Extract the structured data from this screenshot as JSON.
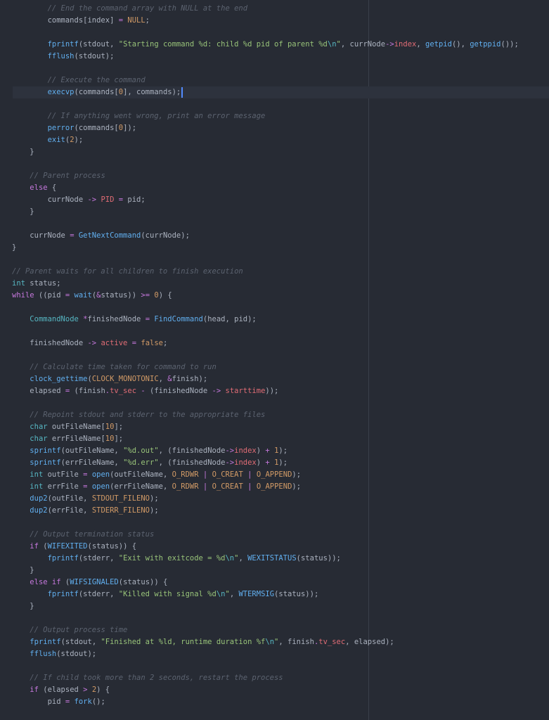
{
  "editor": {
    "cursor_line": 7,
    "lines": [
      [
        [
          "plain",
          "        "
        ],
        [
          "comment",
          "// End the command array with NULL at the end"
        ]
      ],
      [
        [
          "plain",
          "        commands[index] "
        ],
        [
          "op",
          "="
        ],
        [
          "plain",
          " "
        ],
        [
          "const",
          "NULL"
        ],
        [
          "plain",
          ";"
        ]
      ],
      [],
      [
        [
          "plain",
          "        "
        ],
        [
          "func",
          "fprintf"
        ],
        [
          "plain",
          "(stdout, "
        ],
        [
          "string",
          "\"Starting command %d: child %d pid of parent %d"
        ],
        [
          "escape",
          "\\n"
        ],
        [
          "string",
          "\""
        ],
        [
          "plain",
          ", currNode"
        ],
        [
          "op",
          "->"
        ],
        [
          "member",
          "index"
        ],
        [
          "plain",
          ", "
        ],
        [
          "func",
          "getpid"
        ],
        [
          "plain",
          "(), "
        ],
        [
          "func",
          "getppid"
        ],
        [
          "plain",
          "());"
        ]
      ],
      [
        [
          "plain",
          "        "
        ],
        [
          "func",
          "fflush"
        ],
        [
          "plain",
          "(stdout);"
        ]
      ],
      [],
      [
        [
          "plain",
          "        "
        ],
        [
          "comment",
          "// Execute the command"
        ]
      ],
      [
        [
          "plain",
          "        "
        ],
        [
          "func",
          "execvp"
        ],
        [
          "plain",
          "(commands["
        ],
        [
          "const",
          "0"
        ],
        [
          "plain",
          "], commands);"
        ]
      ],
      [],
      [
        [
          "plain",
          "        "
        ],
        [
          "comment",
          "// If anything went wrong, print an error message"
        ]
      ],
      [
        [
          "plain",
          "        "
        ],
        [
          "func",
          "perror"
        ],
        [
          "plain",
          "(commands["
        ],
        [
          "const",
          "0"
        ],
        [
          "plain",
          "]);"
        ]
      ],
      [
        [
          "plain",
          "        "
        ],
        [
          "func",
          "exit"
        ],
        [
          "plain",
          "("
        ],
        [
          "const",
          "2"
        ],
        [
          "plain",
          ");"
        ]
      ],
      [
        [
          "plain",
          "    }"
        ]
      ],
      [],
      [
        [
          "plain",
          "    "
        ],
        [
          "comment",
          "// Parent process"
        ]
      ],
      [
        [
          "plain",
          "    "
        ],
        [
          "keyword",
          "else"
        ],
        [
          "plain",
          " {"
        ]
      ],
      [
        [
          "plain",
          "        currNode "
        ],
        [
          "op",
          "->"
        ],
        [
          "plain",
          " "
        ],
        [
          "member",
          "PID"
        ],
        [
          "plain",
          " "
        ],
        [
          "op",
          "="
        ],
        [
          "plain",
          " pid;"
        ]
      ],
      [
        [
          "plain",
          "    }"
        ]
      ],
      [],
      [
        [
          "plain",
          "    currNode "
        ],
        [
          "op",
          "="
        ],
        [
          "plain",
          " "
        ],
        [
          "func",
          "GetNextCommand"
        ],
        [
          "plain",
          "(currNode);"
        ]
      ],
      [
        [
          "plain",
          "}"
        ]
      ],
      [],
      [
        [
          "comment",
          "// Parent waits for all children to finish execution"
        ]
      ],
      [
        [
          "type",
          "int"
        ],
        [
          "plain",
          " status;"
        ]
      ],
      [
        [
          "keyword",
          "while"
        ],
        [
          "plain",
          " ((pid "
        ],
        [
          "op",
          "="
        ],
        [
          "plain",
          " "
        ],
        [
          "func",
          "wait"
        ],
        [
          "plain",
          "("
        ],
        [
          "op",
          "&"
        ],
        [
          "plain",
          "status)) "
        ],
        [
          "op",
          ">="
        ],
        [
          "plain",
          " "
        ],
        [
          "const",
          "0"
        ],
        [
          "plain",
          ") {"
        ]
      ],
      [],
      [
        [
          "plain",
          "    "
        ],
        [
          "type",
          "CommandNode"
        ],
        [
          "plain",
          " "
        ],
        [
          "op",
          "*"
        ],
        [
          "plain",
          "finishedNode "
        ],
        [
          "op",
          "="
        ],
        [
          "plain",
          " "
        ],
        [
          "func",
          "FindCommand"
        ],
        [
          "plain",
          "(head, pid);"
        ]
      ],
      [],
      [
        [
          "plain",
          "    finishedNode "
        ],
        [
          "op",
          "->"
        ],
        [
          "plain",
          " "
        ],
        [
          "member",
          "active"
        ],
        [
          "plain",
          " "
        ],
        [
          "op",
          "="
        ],
        [
          "plain",
          " "
        ],
        [
          "const",
          "false"
        ],
        [
          "plain",
          ";"
        ]
      ],
      [],
      [
        [
          "plain",
          "    "
        ],
        [
          "comment",
          "// Calculate time taken for command to run"
        ]
      ],
      [
        [
          "plain",
          "    "
        ],
        [
          "func",
          "clock_gettime"
        ],
        [
          "plain",
          "("
        ],
        [
          "const",
          "CLOCK_MONOTONIC"
        ],
        [
          "plain",
          ", "
        ],
        [
          "op",
          "&"
        ],
        [
          "plain",
          "finish);"
        ]
      ],
      [
        [
          "plain",
          "    elapsed "
        ],
        [
          "op",
          "="
        ],
        [
          "plain",
          " (finish"
        ],
        [
          "op",
          "."
        ],
        [
          "member",
          "tv_sec"
        ],
        [
          "plain",
          " "
        ],
        [
          "op",
          "-"
        ],
        [
          "plain",
          " (finishedNode "
        ],
        [
          "op",
          "->"
        ],
        [
          "plain",
          " "
        ],
        [
          "member",
          "starttime"
        ],
        [
          "plain",
          "));"
        ]
      ],
      [],
      [
        [
          "plain",
          "    "
        ],
        [
          "comment",
          "// Repoint stdout and stderr to the appropriate files"
        ]
      ],
      [
        [
          "plain",
          "    "
        ],
        [
          "type",
          "char"
        ],
        [
          "plain",
          " outFileName["
        ],
        [
          "const",
          "10"
        ],
        [
          "plain",
          "];"
        ]
      ],
      [
        [
          "plain",
          "    "
        ],
        [
          "type",
          "char"
        ],
        [
          "plain",
          " errFileName["
        ],
        [
          "const",
          "10"
        ],
        [
          "plain",
          "];"
        ]
      ],
      [
        [
          "plain",
          "    "
        ],
        [
          "func",
          "sprintf"
        ],
        [
          "plain",
          "(outFileName, "
        ],
        [
          "string",
          "\"%d.out\""
        ],
        [
          "plain",
          ", (finishedNode"
        ],
        [
          "op",
          "->"
        ],
        [
          "member",
          "index"
        ],
        [
          "plain",
          ") "
        ],
        [
          "op",
          "+"
        ],
        [
          "plain",
          " "
        ],
        [
          "const",
          "1"
        ],
        [
          "plain",
          ");"
        ]
      ],
      [
        [
          "plain",
          "    "
        ],
        [
          "func",
          "sprintf"
        ],
        [
          "plain",
          "(errFileName, "
        ],
        [
          "string",
          "\"%d.err\""
        ],
        [
          "plain",
          ", (finishedNode"
        ],
        [
          "op",
          "->"
        ],
        [
          "member",
          "index"
        ],
        [
          "plain",
          ") "
        ],
        [
          "op",
          "+"
        ],
        [
          "plain",
          " "
        ],
        [
          "const",
          "1"
        ],
        [
          "plain",
          ");"
        ]
      ],
      [
        [
          "plain",
          "    "
        ],
        [
          "type",
          "int"
        ],
        [
          "plain",
          " outFile "
        ],
        [
          "op",
          "="
        ],
        [
          "plain",
          " "
        ],
        [
          "func",
          "open"
        ],
        [
          "plain",
          "(outFileName, "
        ],
        [
          "const",
          "O_RDWR"
        ],
        [
          "plain",
          " "
        ],
        [
          "op",
          "|"
        ],
        [
          "plain",
          " "
        ],
        [
          "const",
          "O_CREAT"
        ],
        [
          "plain",
          " "
        ],
        [
          "op",
          "|"
        ],
        [
          "plain",
          " "
        ],
        [
          "const",
          "O_APPEND"
        ],
        [
          "plain",
          ");"
        ]
      ],
      [
        [
          "plain",
          "    "
        ],
        [
          "type",
          "int"
        ],
        [
          "plain",
          " errFile "
        ],
        [
          "op",
          "="
        ],
        [
          "plain",
          " "
        ],
        [
          "func",
          "open"
        ],
        [
          "plain",
          "(errFileName, "
        ],
        [
          "const",
          "O_RDWR"
        ],
        [
          "plain",
          " "
        ],
        [
          "op",
          "|"
        ],
        [
          "plain",
          " "
        ],
        [
          "const",
          "O_CREAT"
        ],
        [
          "plain",
          " "
        ],
        [
          "op",
          "|"
        ],
        [
          "plain",
          " "
        ],
        [
          "const",
          "O_APPEND"
        ],
        [
          "plain",
          ");"
        ]
      ],
      [
        [
          "plain",
          "    "
        ],
        [
          "func",
          "dup2"
        ],
        [
          "plain",
          "(outFile, "
        ],
        [
          "const",
          "STDOUT_FILENO"
        ],
        [
          "plain",
          ");"
        ]
      ],
      [
        [
          "plain",
          "    "
        ],
        [
          "func",
          "dup2"
        ],
        [
          "plain",
          "(errFile, "
        ],
        [
          "const",
          "STDERR_FILENO"
        ],
        [
          "plain",
          ");"
        ]
      ],
      [],
      [
        [
          "plain",
          "    "
        ],
        [
          "comment",
          "// Output termination status"
        ]
      ],
      [
        [
          "plain",
          "    "
        ],
        [
          "keyword",
          "if"
        ],
        [
          "plain",
          " ("
        ],
        [
          "func",
          "WIFEXITED"
        ],
        [
          "plain",
          "(status)) {"
        ]
      ],
      [
        [
          "plain",
          "        "
        ],
        [
          "func",
          "fprintf"
        ],
        [
          "plain",
          "(stderr, "
        ],
        [
          "string",
          "\"Exit with exitcode = %d"
        ],
        [
          "escape",
          "\\n"
        ],
        [
          "string",
          "\""
        ],
        [
          "plain",
          ", "
        ],
        [
          "func",
          "WEXITSTATUS"
        ],
        [
          "plain",
          "(status));"
        ]
      ],
      [
        [
          "plain",
          "    }"
        ]
      ],
      [
        [
          "plain",
          "    "
        ],
        [
          "keyword",
          "else if"
        ],
        [
          "plain",
          " ("
        ],
        [
          "func",
          "WIFSIGNALED"
        ],
        [
          "plain",
          "(status)) {"
        ]
      ],
      [
        [
          "plain",
          "        "
        ],
        [
          "func",
          "fprintf"
        ],
        [
          "plain",
          "(stderr, "
        ],
        [
          "string",
          "\"Killed with signal %d"
        ],
        [
          "escape",
          "\\n"
        ],
        [
          "string",
          "\""
        ],
        [
          "plain",
          ", "
        ],
        [
          "func",
          "WTERMSIG"
        ],
        [
          "plain",
          "(status));"
        ]
      ],
      [
        [
          "plain",
          "    }"
        ]
      ],
      [],
      [
        [
          "plain",
          "    "
        ],
        [
          "comment",
          "// Output process time"
        ]
      ],
      [
        [
          "plain",
          "    "
        ],
        [
          "func",
          "fprintf"
        ],
        [
          "plain",
          "(stdout, "
        ],
        [
          "string",
          "\"Finished at %ld, runtime duration %f"
        ],
        [
          "escape",
          "\\n"
        ],
        [
          "string",
          "\""
        ],
        [
          "plain",
          ", finish"
        ],
        [
          "op",
          "."
        ],
        [
          "member",
          "tv_sec"
        ],
        [
          "plain",
          ", elapsed);"
        ]
      ],
      [
        [
          "plain",
          "    "
        ],
        [
          "func",
          "fflush"
        ],
        [
          "plain",
          "(stdout);"
        ]
      ],
      [],
      [
        [
          "plain",
          "    "
        ],
        [
          "comment",
          "// If child took more than 2 seconds, restart the process"
        ]
      ],
      [
        [
          "plain",
          "    "
        ],
        [
          "keyword",
          "if"
        ],
        [
          "plain",
          " (elapsed "
        ],
        [
          "op",
          ">"
        ],
        [
          "plain",
          " "
        ],
        [
          "const",
          "2"
        ],
        [
          "plain",
          ") {"
        ]
      ],
      [
        [
          "plain",
          "        pid "
        ],
        [
          "op",
          "="
        ],
        [
          "plain",
          " "
        ],
        [
          "func",
          "fork"
        ],
        [
          "plain",
          "();"
        ]
      ]
    ]
  }
}
